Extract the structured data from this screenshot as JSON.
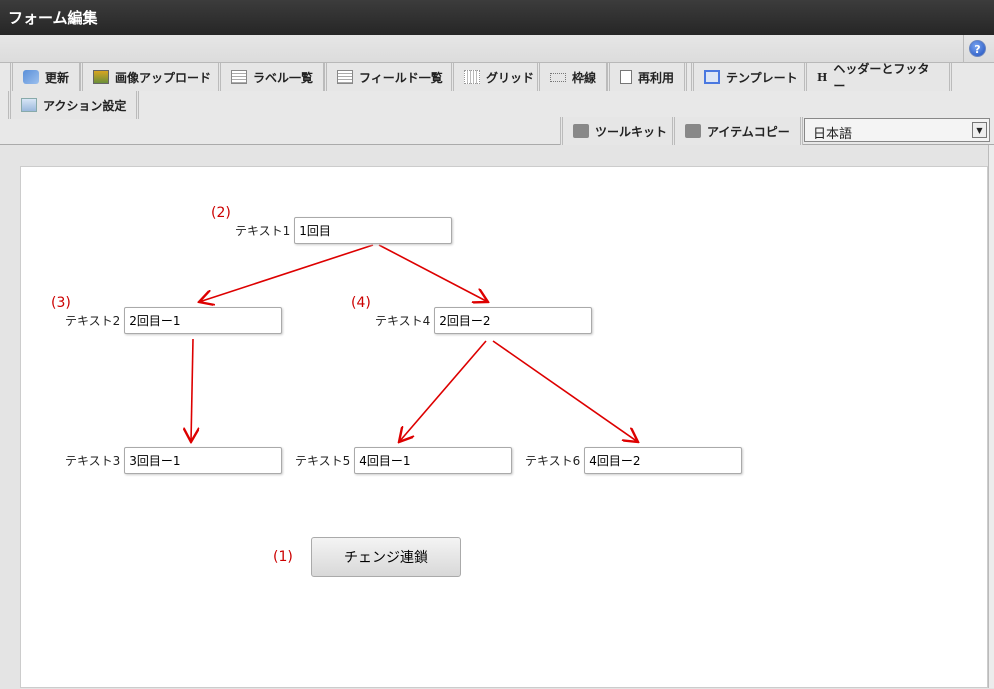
{
  "window": {
    "title": "フォーム編集"
  },
  "help_icon": "?",
  "toolbar": {
    "items": [
      {
        "label": "更新",
        "icon": "refresh-icon"
      },
      {
        "label": "画像アップロード",
        "icon": "image-upload-icon"
      },
      {
        "label": "ラベル一覧",
        "icon": "list-icon"
      },
      {
        "label": "フィールド一覧",
        "icon": "list-icon"
      },
      {
        "label": "グリッド",
        "icon": "grid-icon"
      },
      {
        "label": "枠線",
        "icon": "border-icon"
      },
      {
        "label": "再利用",
        "icon": "copy-icon"
      },
      {
        "label": "テンプレート",
        "icon": "template-icon"
      },
      {
        "label": "ヘッダーとフッター",
        "icon": "header-icon"
      },
      {
        "label": "アクション設定",
        "icon": "action-icon"
      }
    ],
    "toolkit": "ツールキット",
    "item_copy": "アイテムコピー",
    "language": "日本語"
  },
  "form": {
    "fields": [
      {
        "label": "テキスト1",
        "value": "1回目"
      },
      {
        "label": "テキスト2",
        "value": "2回目ー1"
      },
      {
        "label": "テキスト4",
        "value": "2回目ー2"
      },
      {
        "label": "テキスト3",
        "value": "3回目ー1"
      },
      {
        "label": "テキスト5",
        "value": "4回目ー1"
      },
      {
        "label": "テキスト6",
        "value": "4回目ー2"
      }
    ],
    "annotations": [
      "(1)",
      "(2)",
      "(3)",
      "(4)"
    ],
    "button": "チェンジ連鎖",
    "arrow_color": "#dd0000"
  }
}
